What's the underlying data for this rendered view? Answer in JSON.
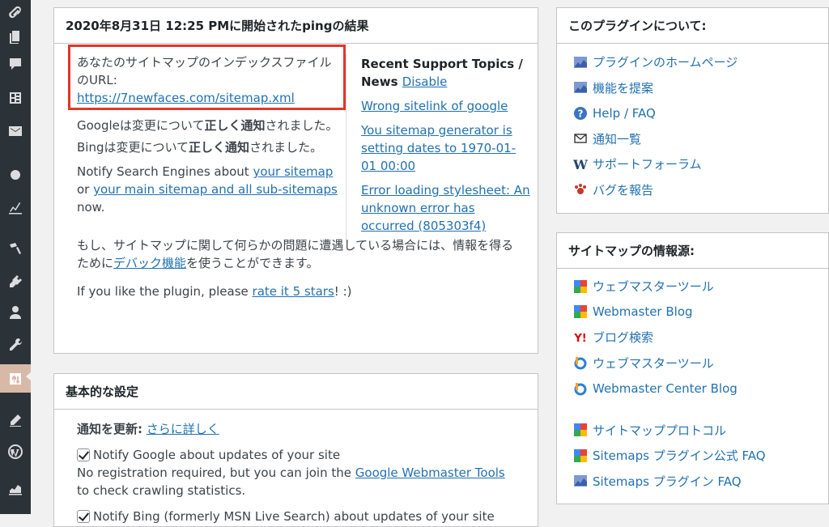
{
  "sidebar": {
    "icons": [
      "link-icon",
      "pages-icon",
      "comments-icon",
      "forms-icon",
      "mail-icon",
      "circle-icon",
      "analytics-icon",
      "appearance-icon",
      "plugins-icon",
      "users-icon",
      "tools-icon",
      "sitemap-settings-icon",
      "edit-icon",
      "wordpress-icon",
      "chart-icon"
    ]
  },
  "result_box": {
    "title": "2020年8月31日 12:25 PMに開始されたpingの結果",
    "index_url_label": "あなたのサイトマップのインデックスファイルのURL:",
    "index_url": "https://7newfaces.com/sitemap.xml",
    "google_pre": "Googleは変更について",
    "google_bold": "正しく通知",
    "google_post": "されました。",
    "bing_pre": "Bingは変更について",
    "bing_bold": "正しく通知",
    "bing_post": "されました。",
    "notify_pre": "Notify Search Engines about ",
    "notify_link1": "your sitemap",
    "notify_or": "or ",
    "notify_link2": "your main sitemap and all sub-sitemaps",
    "notify_post": "now.",
    "problem_pre": "もし、サイトマップに関して何らかの問題に遭遇している場合には、情報を得るために",
    "problem_link": "デバック機能",
    "problem_post": "を使うことができます。",
    "like_pre": "If you like the plugin, please ",
    "like_link": "rate it 5 stars",
    "like_post": "! :)",
    "support": {
      "heading": "Recent Support Topics / News",
      "disable_label": "Disable",
      "topics": [
        "Wrong sitelink of google",
        "You sitemap generator is setting dates to 1970-01-01 00:00",
        "Error loading stylesheet: An unknown error has occurred (805303f4)"
      ]
    }
  },
  "settings_box": {
    "title": "基本的な設定",
    "update_label": "通知を更新:",
    "update_link": "さらに詳しく",
    "google_option": "Notify Google about updates of your site",
    "google_desc_pre": "No registration required, but you can join the ",
    "google_desc_link": "Google Webmaster Tools",
    "google_desc_post": "to check crawling statistics.",
    "bing_option": "Notify Bing (formerly MSN Live Search) about updates of your site"
  },
  "about_box": {
    "title": "このプラグインについて:",
    "links": [
      {
        "icon": "sitemap-chart-icon",
        "label": "プラグインのホームページ"
      },
      {
        "icon": "sitemap-chart-icon",
        "label": "機能を提案"
      },
      {
        "icon": "help-icon",
        "label": "Help / FAQ"
      },
      {
        "icon": "mail-icon",
        "label": "通知一覧"
      },
      {
        "icon": "wordpress-w-icon",
        "label": "サポートフォーラム"
      },
      {
        "icon": "bug-icon",
        "label": "バグを報告"
      }
    ]
  },
  "sources_box": {
    "title": "サイトマップの情報源:",
    "links": [
      {
        "icon": "google-icon",
        "label": "ウェブマスターツール"
      },
      {
        "icon": "google-icon",
        "label": "Webmaster Blog"
      },
      {
        "icon": "yahoo-icon",
        "label": "ブログ検索"
      },
      {
        "icon": "bing-icon",
        "label": "ウェブマスターツール"
      },
      {
        "icon": "bing-icon",
        "label": "Webmaster Center Blog"
      },
      {
        "icon": "google-icon",
        "label": "サイトマッププロトコル"
      },
      {
        "icon": "google-icon",
        "label": "Sitemaps プラグイン公式 FAQ"
      },
      {
        "icon": "sitemap-chart-icon",
        "label": "Sitemaps プラグイン FAQ"
      }
    ]
  },
  "colors": {
    "link": "#2271b1",
    "sidebar_bg": "#2c3338",
    "highlight_frame": "#e2362b",
    "current_menu": "#d8b9a7"
  }
}
